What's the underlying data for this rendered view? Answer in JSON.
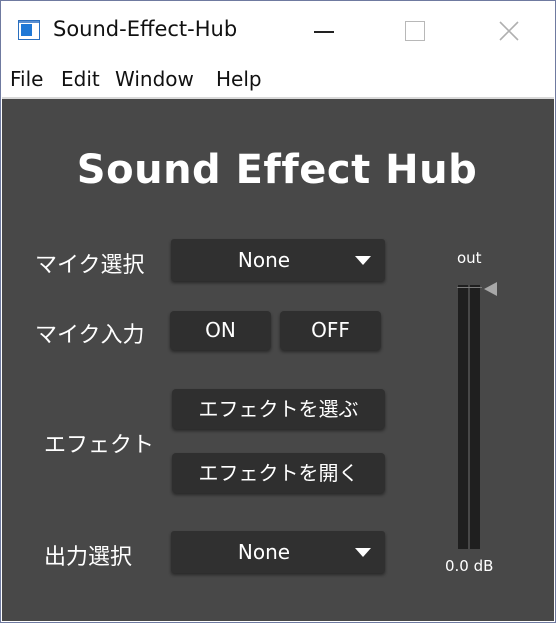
{
  "window": {
    "title": "Sound-Effect-Hub"
  },
  "menu": {
    "items": [
      "File",
      "Edit",
      "Window",
      "Help"
    ]
  },
  "app": {
    "title": "Sound Effect Hub",
    "mic_select": {
      "label": "マイク選択",
      "value": "None"
    },
    "mic_input": {
      "label": "マイク入力",
      "on_label": "ON",
      "off_label": "OFF"
    },
    "effect": {
      "label": "エフェクト",
      "choose_label": "エフェクトを選ぶ",
      "open_label": "エフェクトを開く"
    },
    "output_select": {
      "label": "出力選択",
      "value": "None"
    },
    "meter": {
      "label": "out",
      "value": "0.0 dB"
    }
  },
  "colors": {
    "background": "#484848",
    "control": "#2f2f2f",
    "text": "#ffffff"
  },
  "icons": [
    "app-icon",
    "minimize-icon",
    "maximize-icon",
    "close-icon",
    "chevron-down-icon",
    "slider-handle-icon"
  ]
}
